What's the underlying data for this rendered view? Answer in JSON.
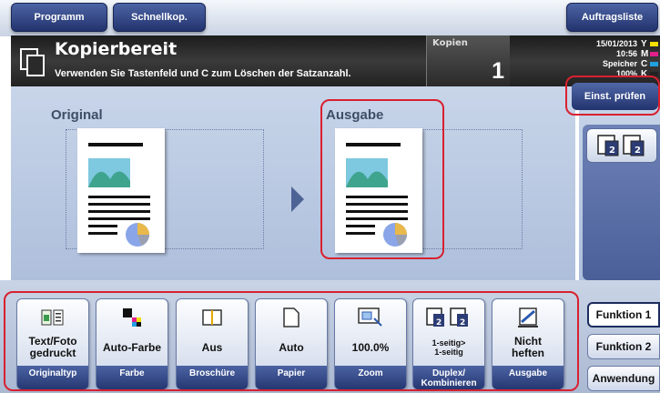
{
  "topbar": {
    "tabs": [
      {
        "label": "Programm"
      },
      {
        "label": "Schnellkop."
      }
    ],
    "job_list_label": "Auftragsliste"
  },
  "header": {
    "title": "Kopierbereit",
    "subtitle": "Verwenden Sie Tastenfeld und C zum Löschen der Satzanzahl.",
    "copies_label": "Kopien",
    "copies_value": "1",
    "date": "15/01/2013",
    "time": "10:56",
    "memory_label": "Speicher",
    "memory_value": "100%",
    "toner": [
      {
        "letter": "Y",
        "color": "#f2e000"
      },
      {
        "letter": "M",
        "color": "#e0208a"
      },
      {
        "letter": "C",
        "color": "#20a0e0"
      },
      {
        "letter": "K",
        "color": "#222222"
      }
    ]
  },
  "main": {
    "original_label": "Original",
    "output_label": "Ausgabe",
    "highlight_color": "#d9202f"
  },
  "right": {
    "check_settings_label": "Einst. prüfen",
    "duplex_icon": "duplex-pages-icon"
  },
  "functions": [
    {
      "value": "Text/Foto\ngedruckt",
      "caption": "Originaltyp",
      "icon": "text-photo-icon"
    },
    {
      "value": "Auto-Farbe",
      "caption": "Farbe",
      "icon": "color-icon"
    },
    {
      "value": "Aus",
      "caption": "Broschüre",
      "icon": "booklet-icon"
    },
    {
      "value": "Auto",
      "caption": "Papier",
      "icon": "paper-icon"
    },
    {
      "value": "100.0%",
      "caption": "Zoom",
      "icon": "zoom-icon"
    },
    {
      "value": "1-seitig>\n1-seitig",
      "caption": "Duplex/\nKombinieren",
      "icon": "duplex-icon"
    },
    {
      "value": "Nicht\nheften",
      "caption": "Ausgabe",
      "icon": "staple-icon"
    }
  ],
  "side_tabs": [
    {
      "label": "Funktion 1",
      "active": true
    },
    {
      "label": "Funktion 2",
      "active": false
    },
    {
      "label": "Anwendung",
      "active": false
    }
  ]
}
